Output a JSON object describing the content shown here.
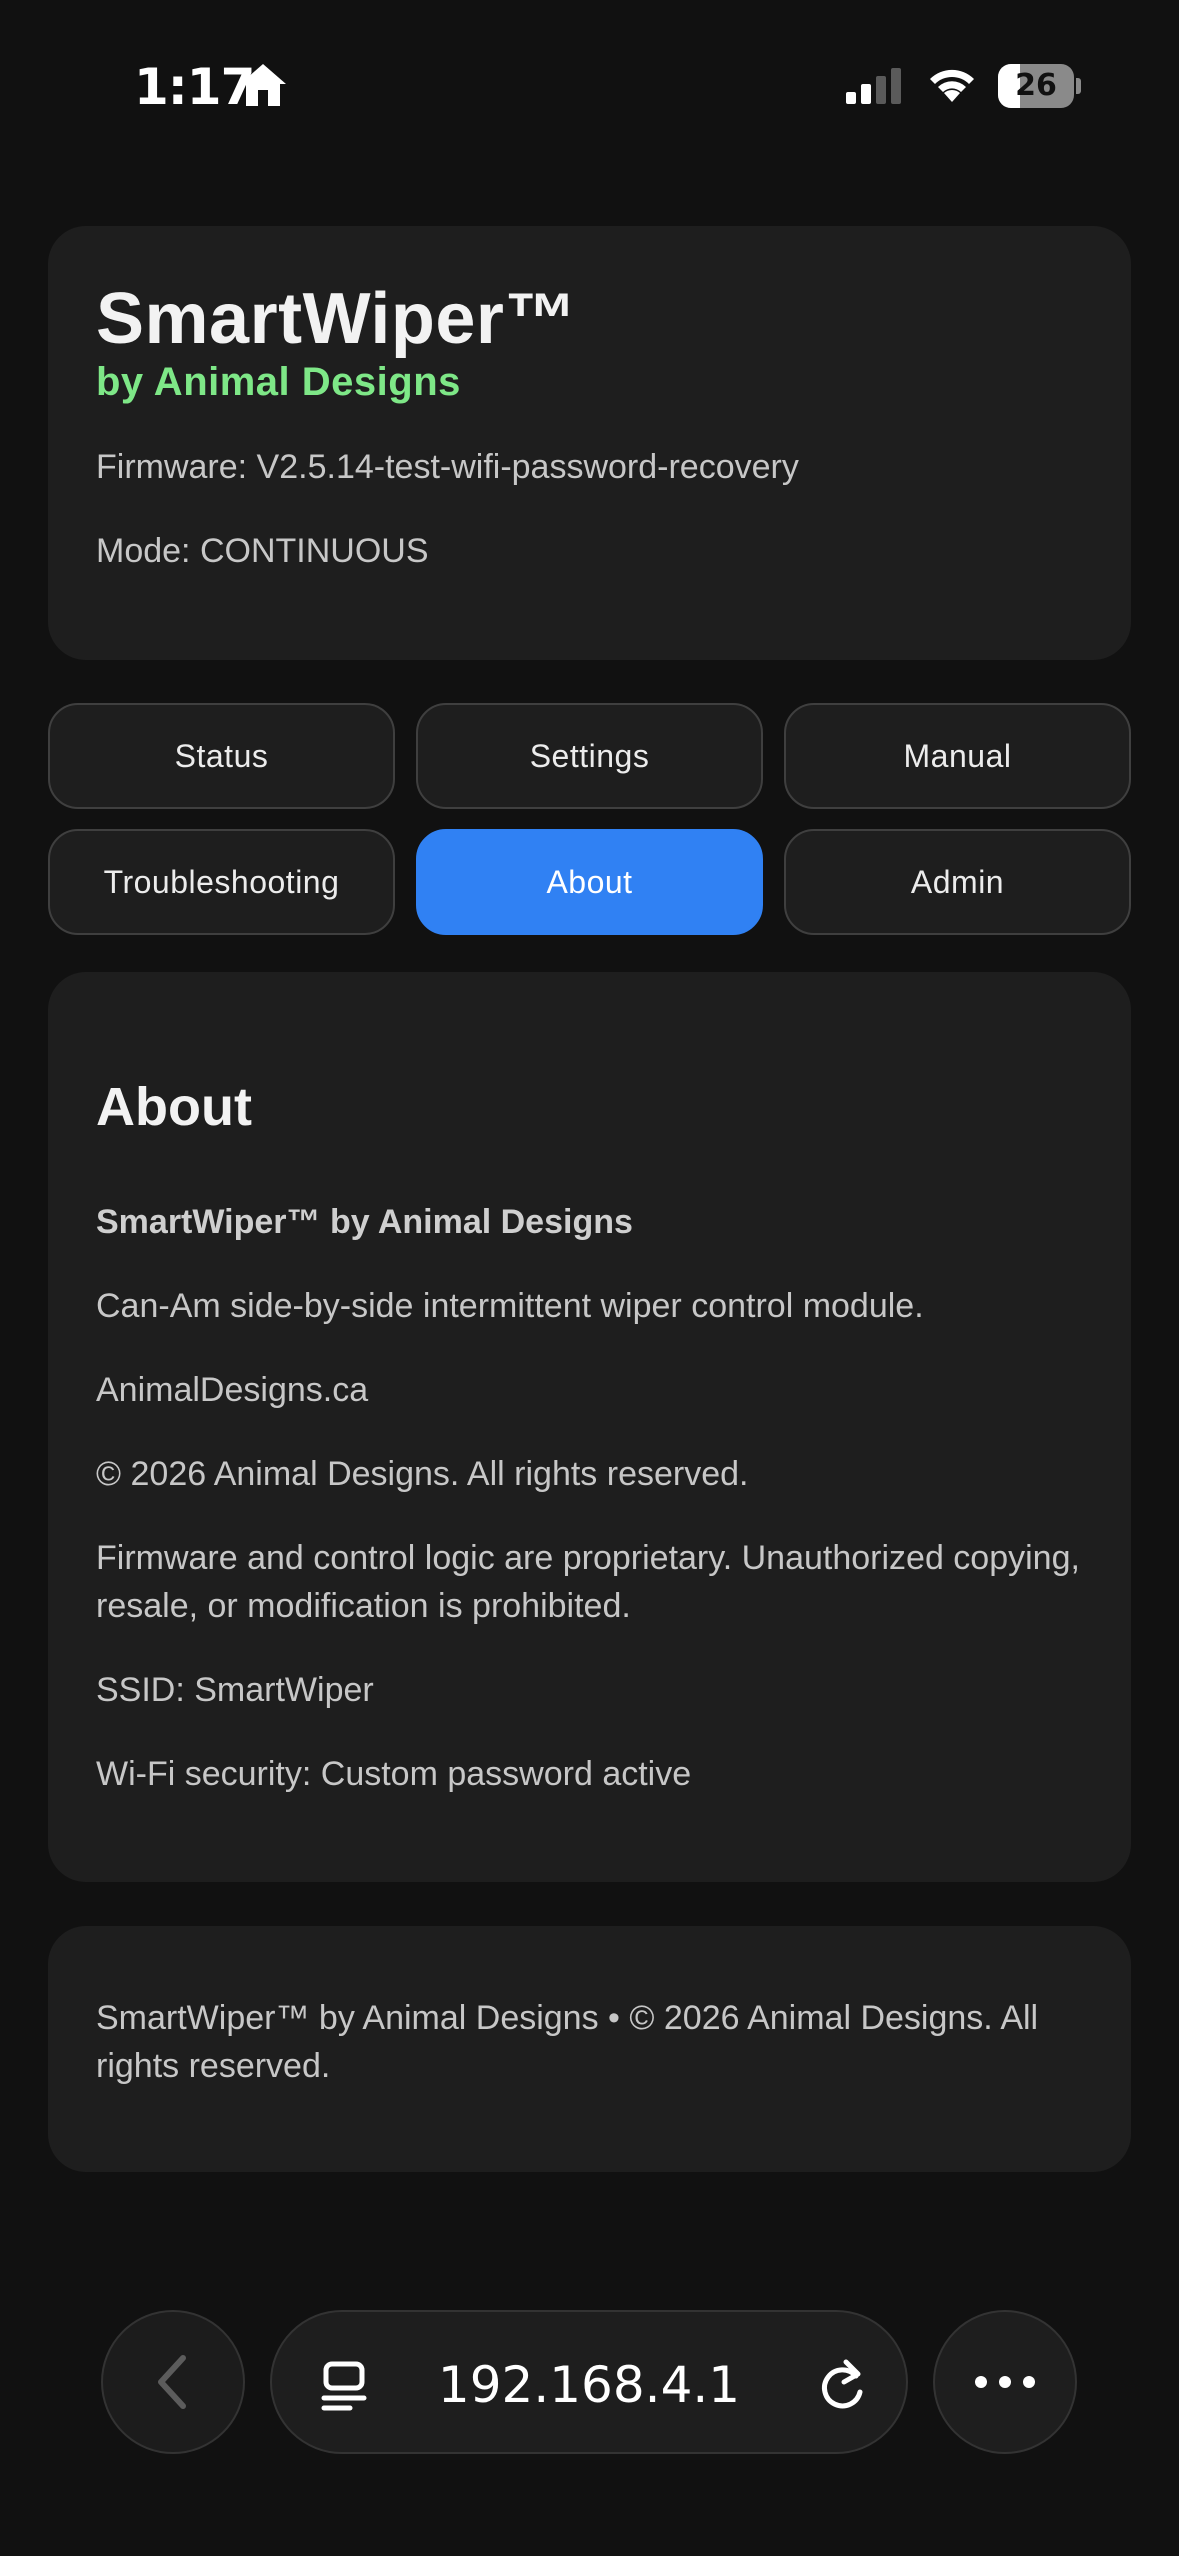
{
  "status_bar": {
    "time": "1:17",
    "battery": "26",
    "icons": [
      "home-icon",
      "cellular-signal-icon",
      "wifi-icon",
      "battery-icon"
    ]
  },
  "header": {
    "title": "SmartWiper™",
    "subtitle": "by Animal Designs",
    "firmware": "Firmware: V2.5.14-test-wifi-password-recovery",
    "mode": "Mode: CONTINUOUS"
  },
  "tabs": [
    {
      "label": "Status",
      "active": false
    },
    {
      "label": "Settings",
      "active": false
    },
    {
      "label": "Manual",
      "active": false
    },
    {
      "label": "Troubleshooting",
      "active": false
    },
    {
      "label": "About",
      "active": true
    },
    {
      "label": "Admin",
      "active": false
    }
  ],
  "about": {
    "heading": "About",
    "product": "SmartWiper™ by Animal Designs",
    "description": "Can-Am side-by-side intermittent wiper control module.",
    "website": "AnimalDesigns.ca",
    "copyright": "© 2026 Animal Designs. All rights reserved.",
    "legal": "Firmware and control logic are proprietary. Unauthorized copying, resale, or modification is prohibited.",
    "ssid": "SSID: SmartWiper",
    "wifi_security": "Wi-Fi security: Custom password active"
  },
  "footer": {
    "text": "SmartWiper™ by Animal Designs • © 2026 Animal Designs. All rights reserved."
  },
  "browser": {
    "url": "192.168.4.1"
  },
  "colors": {
    "background": "#111111",
    "card": "#1e1e1e",
    "accent": "#3081f3",
    "subtitle_green": "#7ee787"
  }
}
